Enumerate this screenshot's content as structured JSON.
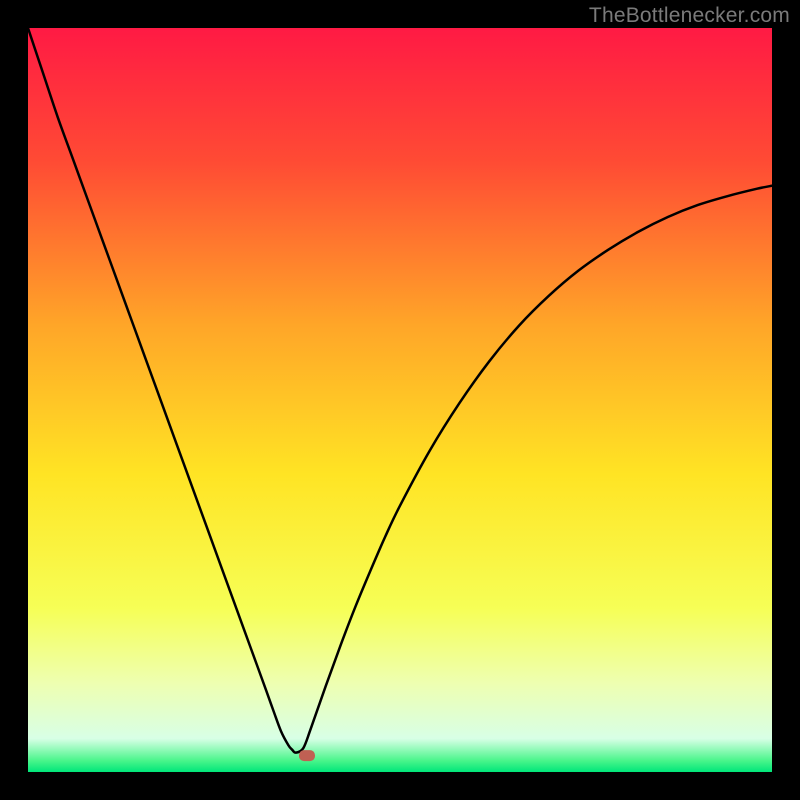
{
  "watermark": "TheBottlenecker.com",
  "chart_data": {
    "type": "line",
    "title": "",
    "xlabel": "",
    "ylabel": "",
    "xlim": [
      0,
      100
    ],
    "ylim": [
      0,
      100
    ],
    "gradient_stops": [
      {
        "offset": 0,
        "color": "#ff1a44"
      },
      {
        "offset": 0.18,
        "color": "#ff4b34"
      },
      {
        "offset": 0.4,
        "color": "#ffa628"
      },
      {
        "offset": 0.6,
        "color": "#ffe424"
      },
      {
        "offset": 0.78,
        "color": "#f6ff56"
      },
      {
        "offset": 0.88,
        "color": "#eeffb0"
      },
      {
        "offset": 0.955,
        "color": "#d8ffe6"
      },
      {
        "offset": 0.985,
        "color": "#48f58a"
      },
      {
        "offset": 1.0,
        "color": "#00e67a"
      }
    ],
    "vertex_x": 36,
    "marker": {
      "x": 37.5,
      "y": 2.2,
      "color": "#c06053"
    },
    "series": [
      {
        "name": "curve",
        "x": [
          0,
          2,
          4,
          6,
          8,
          10,
          12,
          14,
          16,
          18,
          20,
          22,
          24,
          26,
          28,
          30,
          32,
          33,
          34,
          35,
          35.5,
          36,
          37,
          38,
          40,
          42,
          44,
          46,
          48,
          50,
          54,
          58,
          62,
          66,
          70,
          74,
          78,
          82,
          86,
          90,
          94,
          98,
          100
        ],
        "y": [
          100,
          94,
          88,
          82.5,
          77,
          71.5,
          66,
          60.5,
          55,
          49.5,
          44,
          38.5,
          33,
          27.5,
          22,
          16.5,
          11,
          8.2,
          5.5,
          3.6,
          3.0,
          2.6,
          3.2,
          5.8,
          11.5,
          17,
          22.2,
          27,
          31.6,
          35.8,
          43.2,
          49.6,
          55.2,
          60.0,
          64.0,
          67.4,
          70.2,
          72.6,
          74.6,
          76.2,
          77.4,
          78.4,
          78.8
        ]
      }
    ]
  }
}
